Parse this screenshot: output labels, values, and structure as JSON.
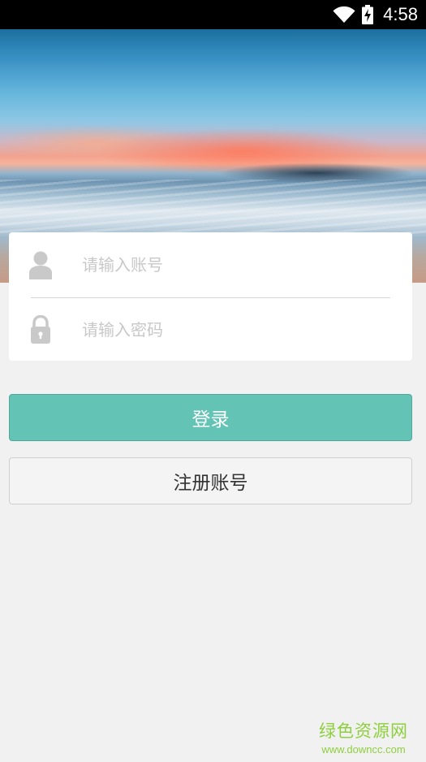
{
  "status_bar": {
    "time": "4:58",
    "icons": [
      "wifi-icon",
      "battery-charging-icon"
    ]
  },
  "hero": {
    "icon": "sunset-beach-image"
  },
  "login_form": {
    "account": {
      "placeholder": "请输入账号",
      "icon": "user-icon"
    },
    "password": {
      "placeholder": "请输入密码",
      "icon": "lock-icon"
    }
  },
  "buttons": {
    "login_label": "登录",
    "register_label": "注册账号"
  },
  "colors": {
    "accent": "#63c4b5",
    "status_bar": "#000000",
    "background": "#f1f1f1",
    "watermark": "#8fcf3e"
  },
  "watermark": {
    "title": "绿色资源网",
    "url": "www.downcc.com"
  }
}
